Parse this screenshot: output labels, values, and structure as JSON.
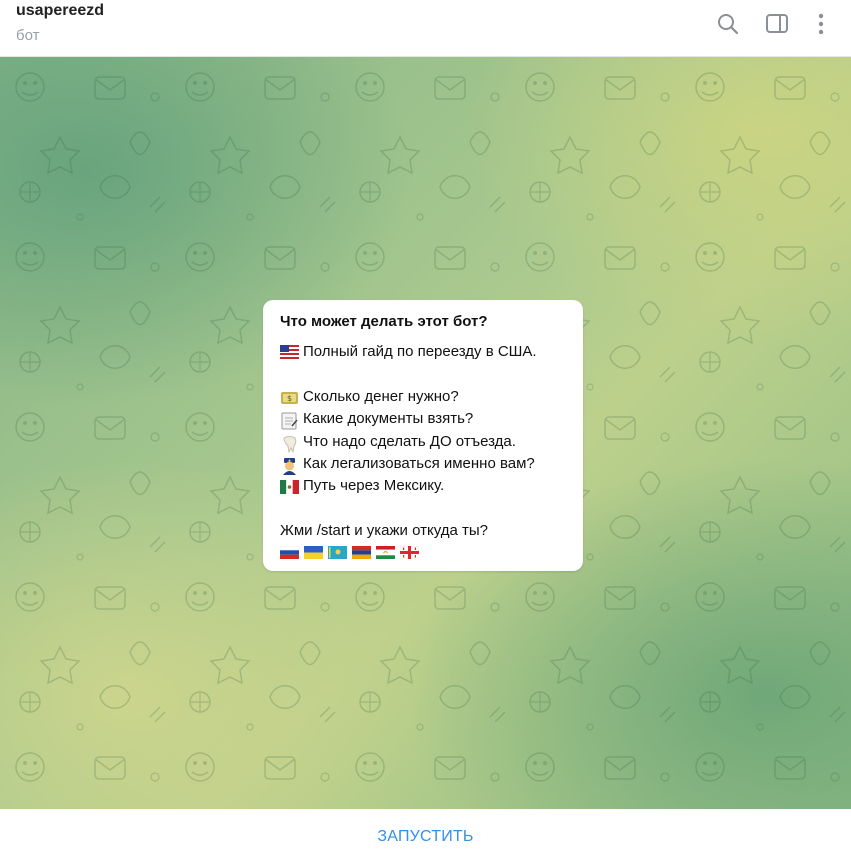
{
  "header": {
    "title": "usapereezd",
    "subtitle": "бот",
    "icons": [
      "search-icon",
      "sidebar-panel-icon",
      "more-vertical-icon"
    ]
  },
  "message": {
    "title": "Что может делать этот бот?",
    "lines": [
      {
        "emoji": "flag-usa",
        "text": " Полный гайд по переезду в США."
      },
      {
        "emoji": "money-bag",
        "text": "Сколько денег нужно?"
      },
      {
        "emoji": "notepad",
        "text": "Какие документы взять?"
      },
      {
        "emoji": "tooth",
        "text": "Что надо сделать ДО отъезда."
      },
      {
        "emoji": "police-officer",
        "text": " Как легализоваться именно вам?"
      },
      {
        "emoji": "flag-mexico",
        "text": "Путь через Мексику."
      }
    ],
    "cta": "Жми /start  и укажи откуда ты?",
    "flags": [
      "flag-russia",
      "flag-ukraine",
      "flag-kazakhstan",
      "flag-armenia",
      "flag-tajikistan",
      "flag-georgia"
    ]
  },
  "bottom": {
    "start_label": "ЗАПУСТИТЬ"
  },
  "colors": {
    "accent": "#3390ec",
    "background_green": "#86b486",
    "background_yellow": "#cbd482"
  }
}
